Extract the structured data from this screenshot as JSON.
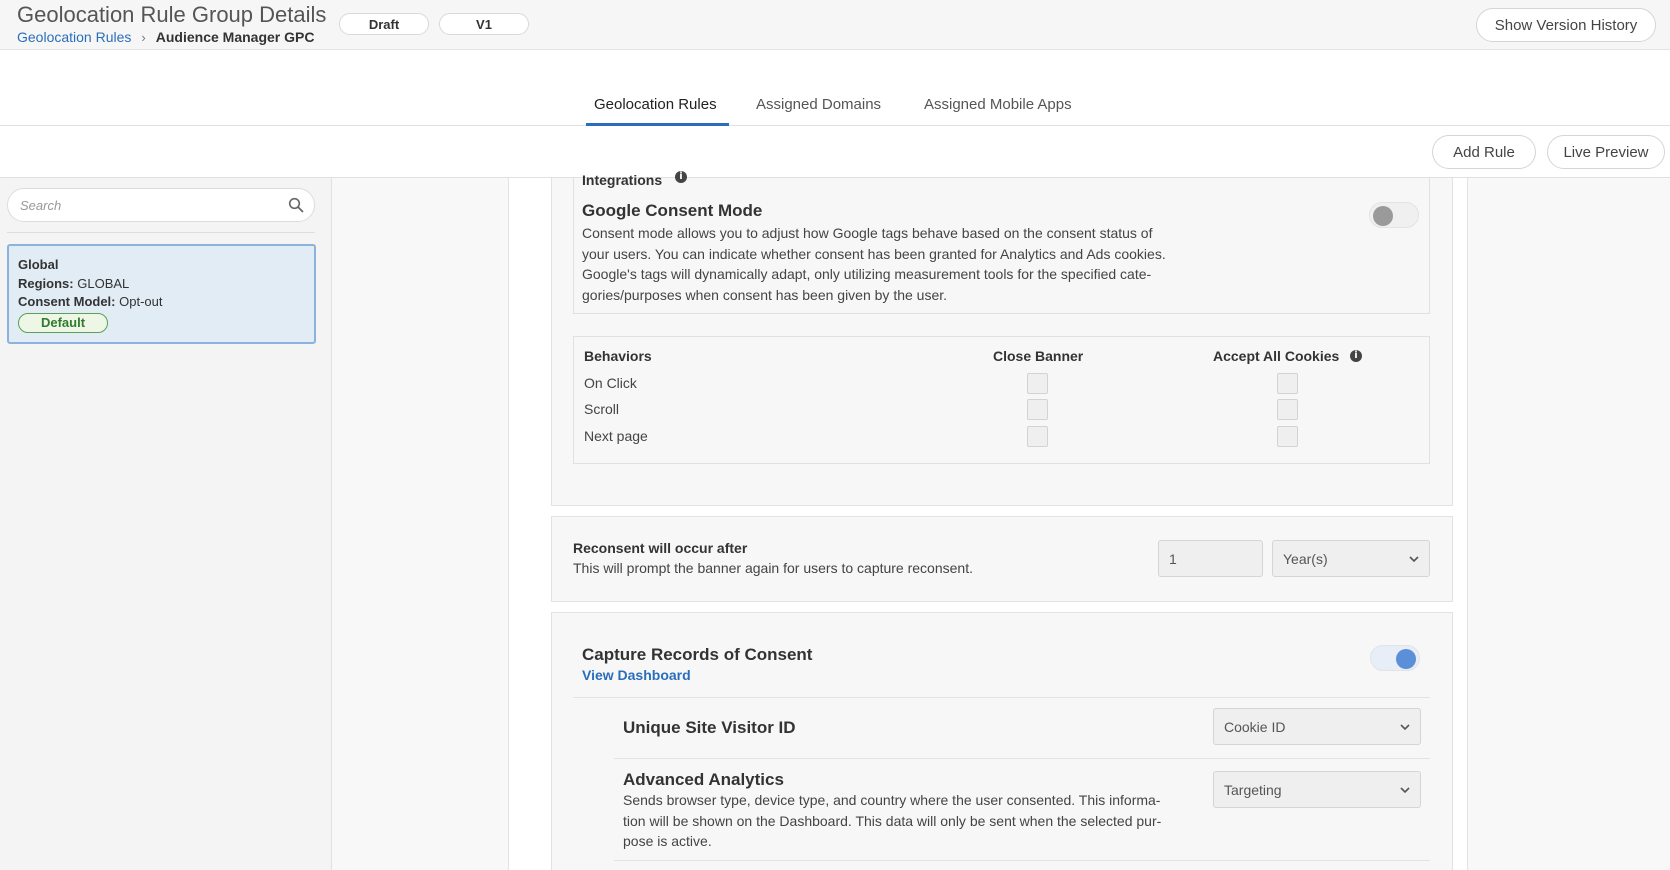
{
  "header": {
    "title": "Geolocation Rule Group Details",
    "breadcrumb": {
      "link": "Geolocation Rules",
      "separator": "›",
      "current": "Audience Manager GPC"
    },
    "status_pill": "Draft",
    "version_pill": "V1",
    "show_version_history": "Show Version History"
  },
  "tabs": [
    {
      "label": "Geolocation Rules",
      "active": true
    },
    {
      "label": "Assigned Domains",
      "active": false
    },
    {
      "label": "Assigned Mobile Apps",
      "active": false
    }
  ],
  "actions": {
    "add_rule": "Add Rule",
    "live_preview": "Live Preview"
  },
  "sidebar": {
    "search_placeholder": "Search",
    "rules": [
      {
        "name": "Global",
        "regions_label": "Regions:",
        "regions_value": "GLOBAL",
        "consent_model_label": "Consent Model:",
        "consent_model_value": "Opt-out",
        "badge": "Default",
        "selected": true
      }
    ]
  },
  "integrations": {
    "title": "Integrations",
    "google_consent_mode": {
      "title": "Google Consent Mode",
      "description": "Consent mode allows you to adjust how Google tags behave based on the consent status of your users. You can indicate whether consent has been granted for Analytics and Ads cookies. Google's tags will dynamically adapt, only utilizing measurement tools for the specified cate-gories/purposes when consent has been given by the user.",
      "enabled": false
    }
  },
  "behaviors": {
    "header": "Behaviors",
    "col_close_banner": "Close Banner",
    "col_accept_all": "Accept All Cookies",
    "rows": [
      {
        "label": "On Click",
        "close_banner": false,
        "accept_all": false
      },
      {
        "label": "Scroll",
        "close_banner": false,
        "accept_all": false
      },
      {
        "label": "Next page",
        "close_banner": false,
        "accept_all": false
      }
    ]
  },
  "reconsent": {
    "title": "Reconsent will occur after",
    "description": "This will prompt the banner again for users to capture reconsent.",
    "value": "1",
    "unit": "Year(s)"
  },
  "records_of_consent": {
    "title": "Capture Records of Consent",
    "view_dashboard": "View Dashboard",
    "enabled": true,
    "unique_site_visitor_id": {
      "title": "Unique Site Visitor ID",
      "value": "Cookie ID"
    },
    "advanced_analytics": {
      "title": "Advanced Analytics",
      "description": "Sends browser type, device type, and country where the user consented. This informa-tion will be shown on the Dashboard. This data will only be sent when the selected pur-pose is active.",
      "value": "Targeting"
    }
  },
  "colors": {
    "accent": "#2a6ebb",
    "selected_card_bg": "#e1ecf5",
    "default_badge": "#2f7a2f",
    "toggle_on": "#5b8fd8"
  }
}
